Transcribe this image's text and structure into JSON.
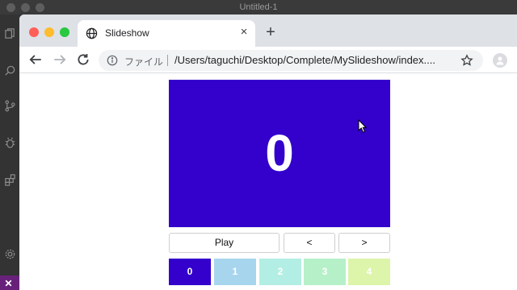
{
  "editor_window": {
    "title": "Untitled-1"
  },
  "browser": {
    "tab": {
      "title": "Slideshow",
      "close": "×"
    },
    "new_tab": "+",
    "address": {
      "scheme_label": "ファイル",
      "url": "/Users/taguchi/Desktop/Complete/MySlideshow/index...."
    }
  },
  "page": {
    "current_slide": "0",
    "slide_color": "#3300cc",
    "controls": {
      "play": "Play",
      "prev": "<",
      "next": ">"
    },
    "thumbnails": [
      {
        "label": "0",
        "color": "#3300cc"
      },
      {
        "label": "1",
        "color": "#a8d5ee"
      },
      {
        "label": "2",
        "color": "#b3eee4"
      },
      {
        "label": "3",
        "color": "#b6f0c8"
      },
      {
        "label": "4",
        "color": "#dcf5aa"
      }
    ]
  }
}
